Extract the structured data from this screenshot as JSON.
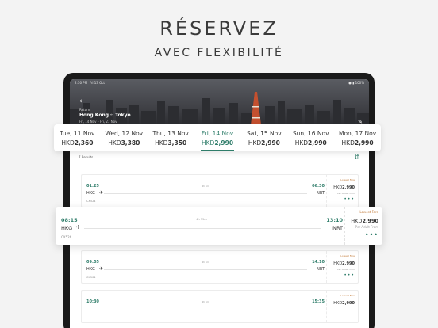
{
  "headline": {
    "line1": "RÉSERVEZ",
    "line2": "AVEC FLEXIBILITÉ"
  },
  "status_bar": {
    "time": "2:30 PM",
    "date": "Fri 13 Oct",
    "right": "●  ▮ 100%"
  },
  "header": {
    "back_icon": "back-arrow-icon",
    "label": "Return",
    "origin": "Hong Kong",
    "destination": "Tokyo",
    "arrow": "⇆",
    "dates": "Fri, 14 Nov – Fri, 21 Nov",
    "edit_icon": "pencil-icon"
  },
  "date_selector": [
    {
      "date": "Tue, 11 Nov",
      "currency": "HKD",
      "amount": "2,360",
      "selected": false
    },
    {
      "date": "Wed, 12 Nov",
      "currency": "HKD",
      "amount": "3,380",
      "selected": false
    },
    {
      "date": "Thu, 13 Nov",
      "currency": "HKD",
      "amount": "3,350",
      "selected": false
    },
    {
      "date": "Fri, 14 Nov",
      "currency": "HKD",
      "amount": "2,990",
      "selected": true
    },
    {
      "date": "Sat, 15 Nov",
      "currency": "HKD",
      "amount": "2,990",
      "selected": false
    },
    {
      "date": "Sun, 16 Nov",
      "currency": "HKD",
      "amount": "2,990",
      "selected": false
    },
    {
      "date": "Mon, 17 Nov",
      "currency": "HKD",
      "amount": "2,990",
      "selected": false
    }
  ],
  "results": {
    "count": "7 Results",
    "filter_icon": "filter-sliders-icon"
  },
  "flights": [
    {
      "dep": "01:25",
      "arr": "06:30",
      "duration": "4h 5m",
      "origin": "HKG",
      "destination": "NRT",
      "flight": "CX524",
      "lowest": "Lowest Fare",
      "currency": "HKD",
      "amount": "2,990",
      "per": "Per Adult From"
    },
    {
      "dep": "08:15",
      "arr": "13:10",
      "duration": "4h 55m",
      "origin": "HKG",
      "destination": "NRT",
      "flight": "CX526",
      "lowest": "Lowest Fare",
      "currency": "HKD",
      "amount": "2,990",
      "per": "Per Adult From"
    },
    {
      "dep": "09:05",
      "arr": "14:10",
      "duration": "4h 5m",
      "origin": "HKG",
      "destination": "NRT",
      "flight": "CX504",
      "lowest": "Lowest Fare",
      "currency": "HKD",
      "amount": "2,990",
      "per": "Per Adult From"
    },
    {
      "dep": "10:30",
      "arr": "15:35",
      "duration": "4h 5m",
      "origin": "HKG",
      "destination": "NRT",
      "flight": "",
      "lowest": "Lowest Fare",
      "currency": "HKD",
      "amount": "2,990",
      "per": "Per Adult From"
    }
  ],
  "colors": {
    "accent": "#2f7d6a",
    "lowest_fare": "#c27b3a",
    "background": "#f3f3f3"
  },
  "icons": {
    "plane": "airplane-icon",
    "more": "more-dots-icon"
  }
}
